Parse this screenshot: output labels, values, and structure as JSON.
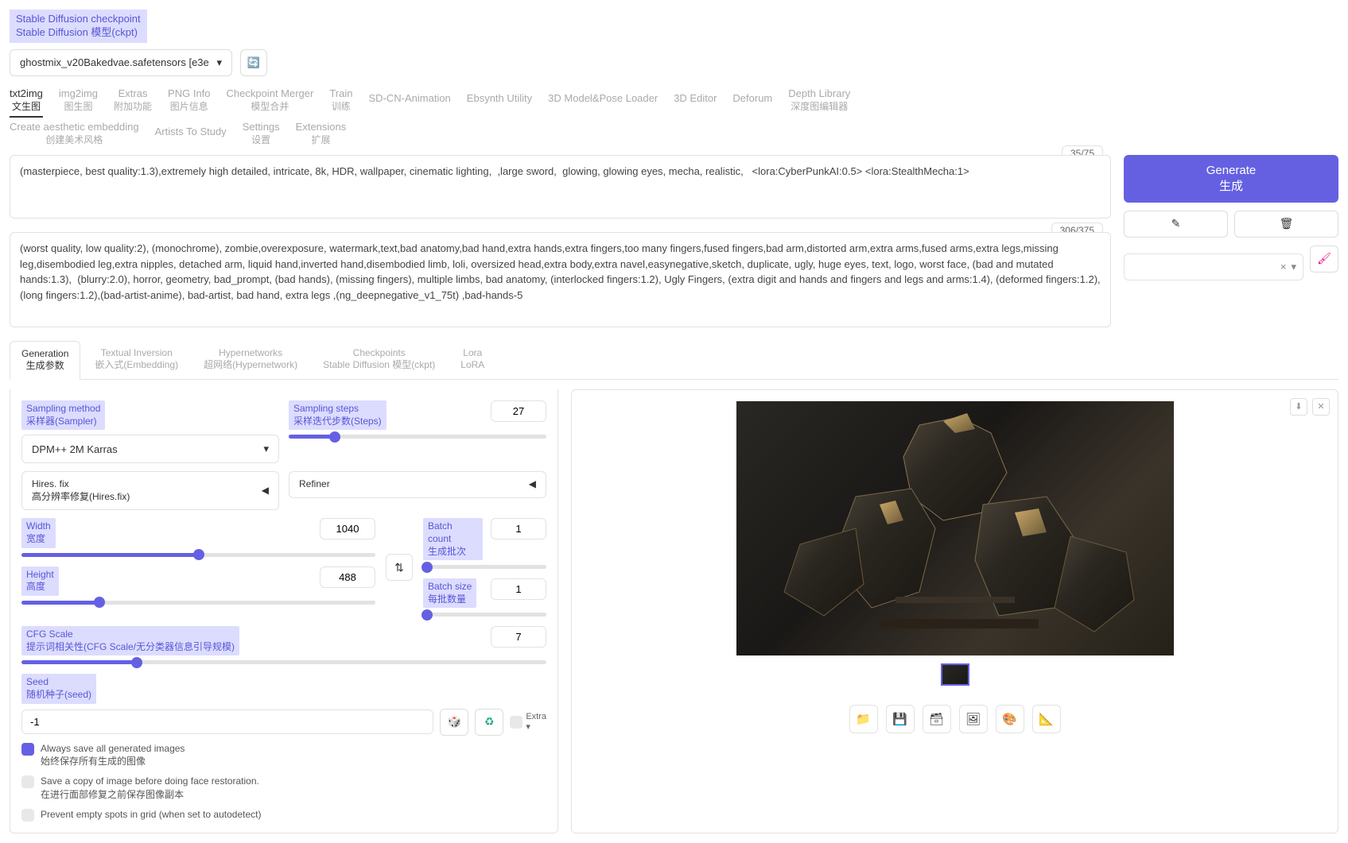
{
  "checkpoint_label": {
    "en": "Stable Diffusion checkpoint",
    "cn": "Stable Diffusion 模型(ckpt)"
  },
  "checkpoint_value": "ghostmix_v20Bakedvae.safetensors [e3e",
  "tabs": {
    "txt2img": {
      "en": "txt2img",
      "cn": "文生图"
    },
    "img2img": {
      "en": "img2img",
      "cn": "图生图"
    },
    "extras": {
      "en": "Extras",
      "cn": "附加功能"
    },
    "pnginfo": {
      "en": "PNG Info",
      "cn": "图片信息"
    },
    "ckptmerge": {
      "en": "Checkpoint Merger",
      "cn": "模型合并"
    },
    "train": {
      "en": "Train",
      "cn": "训练"
    },
    "sdcn": "SD-CN-Animation",
    "ebsynth": "Ebsynth Utility",
    "3dpose": "3D Model&Pose Loader",
    "3ded": "3D Editor",
    "deforum": "Deforum",
    "depth": {
      "en": "Depth Library",
      "cn": "深度图编辑器"
    },
    "aesthetic": {
      "en": "Create aesthetic embedding",
      "cn": "创建美术风格"
    },
    "artists": "Artists To Study",
    "settings": {
      "en": "Settings",
      "cn": "设置"
    },
    "extensions": {
      "en": "Extensions",
      "cn": "扩展"
    }
  },
  "prompt": {
    "positive": "(masterpiece, best quality:1.3),extremely high detailed, intricate, 8k, HDR, wallpaper, cinematic lighting,  ,large sword,  glowing, glowing eyes, mecha, realistic,   <lora:CyberPunkAI:0.5> <lora:StealthMecha:1>",
    "positive_counter": "35/75",
    "negative": "(worst quality, low quality:2), (monochrome), zombie,overexposure, watermark,text,bad anatomy,bad hand,extra hands,extra fingers,too many fingers,fused fingers,bad arm,distorted arm,extra arms,fused arms,extra legs,missing leg,disembodied leg,extra nipples, detached arm, liquid hand,inverted hand,disembodied limb, loli, oversized head,extra body,extra navel,easynegative,sketch, duplicate, ugly, huge eyes, text, logo, worst face, (bad and mutated hands:1.3),  (blurry:2.0), horror, geometry, bad_prompt, (bad hands), (missing fingers), multiple limbs, bad anatomy, (interlocked fingers:1.2), Ugly Fingers, (extra digit and hands and fingers and legs and arms:1.4), (deformed fingers:1.2), (long fingers:1.2),(bad-artist-anime), bad-artist, bad hand, extra legs ,(ng_deepnegative_v1_75t) ,bad-hands-5",
    "negative_counter": "306/375"
  },
  "generate": {
    "en": "Generate",
    "cn": "生成"
  },
  "styles_close": "×",
  "subtabs": {
    "generation": {
      "en": "Generation",
      "cn": "生成参数"
    },
    "textual": {
      "en": "Textual Inversion",
      "cn": "嵌入式(Embedding)"
    },
    "hyper": {
      "en": "Hypernetworks",
      "cn": "超网络(Hypernetwork)"
    },
    "ckpts": {
      "en": "Checkpoints",
      "cn": "Stable Diffusion 模型(ckpt)"
    },
    "lora": {
      "en": "Lora",
      "cn": "LoRA"
    }
  },
  "sampling_method": {
    "label_en": "Sampling method",
    "label_cn": "采样器(Sampler)",
    "value": "DPM++ 2M Karras"
  },
  "sampling_steps": {
    "label_en": "Sampling steps",
    "label_cn": "采样迭代步数(Steps)",
    "value": "27",
    "pct": 18
  },
  "hires": {
    "en": "Hires. fix",
    "cn": "高分辨率修复(Hires.fix)"
  },
  "refiner": "Refiner",
  "width": {
    "label_en": "Width",
    "label_cn": "宽度",
    "value": "1040",
    "pct": 50
  },
  "height": {
    "label_en": "Height",
    "label_cn": "高度",
    "value": "488",
    "pct": 22
  },
  "batch_count": {
    "label_en": "Batch count",
    "label_cn": "生成批次",
    "value": "1",
    "pct": 3
  },
  "batch_size": {
    "label_en": "Batch size",
    "label_cn": "每批数量",
    "value": "1",
    "pct": 3
  },
  "cfg": {
    "label_en": "CFG Scale",
    "label_cn": "提示词相关性(CFG Scale/无分类器信息引导规模)",
    "value": "7",
    "pct": 22
  },
  "seed": {
    "label_en": "Seed",
    "label_cn": "随机种子(seed)",
    "value": "-1"
  },
  "extra_label": "Extra",
  "checks": {
    "always_save": {
      "en": "Always save all generated images",
      "cn": "始终保存所有生成的图像",
      "checked": true
    },
    "save_before_face": {
      "en": "Save a copy of image before doing face restoration.",
      "cn": "在进行面部修复之前保存图像副本",
      "checked": false
    },
    "prevent_empty": {
      "en": "Prevent empty spots in grid (when set to autodetect)",
      "cn": "",
      "checked": false
    }
  },
  "icons": {
    "reload": "🔄",
    "arrow": "▾",
    "acc": "◀",
    "swap": "⇅",
    "dice": "🎲",
    "recycle": "♻",
    "pencil": "✎",
    "trash": "🗑",
    "paint": "🖌",
    "dl": "⬇",
    "close": "✕",
    "folder": "📁",
    "save": "💾",
    "zip": "🗃",
    "img": "🖼",
    "palette": "🎨",
    "ruler": "📐"
  }
}
